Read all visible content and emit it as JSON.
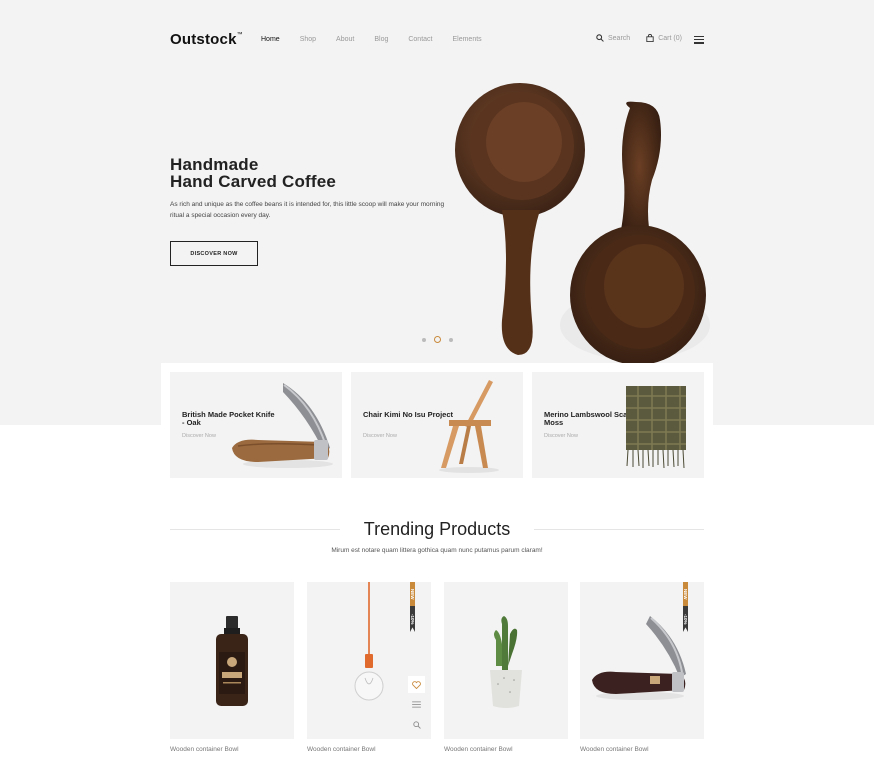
{
  "header": {
    "logo": "Outstock",
    "logo_tm": "™",
    "nav": [
      "Home",
      "Shop",
      "About",
      "Blog",
      "Contact",
      "Elements"
    ],
    "search_label": "Search",
    "cart_label": "Cart",
    "cart_count": "(0)"
  },
  "hero": {
    "title_line1": "Handmade",
    "title_line2": "Hand Carved Coffee",
    "description": "As rich and unique as the coffee beans it is intended for, this little scoop will make your morning ritual a special occasion every day.",
    "button": "DISCOVER NOW",
    "slides": 3,
    "active_slide": 2
  },
  "categories": [
    {
      "title": "British Made Pocket Knife - Oak",
      "link": "Discover Now"
    },
    {
      "title": "Chair Kimi No Isu Project",
      "link": "Discover Now"
    },
    {
      "title": "Merino Lambswool Scarf Moss",
      "link": "Discover Now"
    }
  ],
  "trending": {
    "title": "Trending Products",
    "subtitle": "Mirum est notare quam littera gothica quam nunc putamus parum claram!"
  },
  "products": [
    {
      "name": "Wooden container Bowl",
      "icon": "serum-bottle",
      "badge_new": "",
      "badge_discount": ""
    },
    {
      "name": "Wooden container Bowl",
      "icon": "pendant-lamp",
      "badge_new": "NEW",
      "badge_discount": "-10%"
    },
    {
      "name": "Wooden container Bowl",
      "icon": "cactus-pot",
      "badge_new": "",
      "badge_discount": ""
    },
    {
      "name": "Wooden container Bowl",
      "icon": "pocket-knife",
      "badge_new": "NEW",
      "badge_discount": "-10%"
    }
  ],
  "colors": {
    "accent": "#c98a3c",
    "dark": "#222222",
    "panel": "#f3f3f3"
  }
}
